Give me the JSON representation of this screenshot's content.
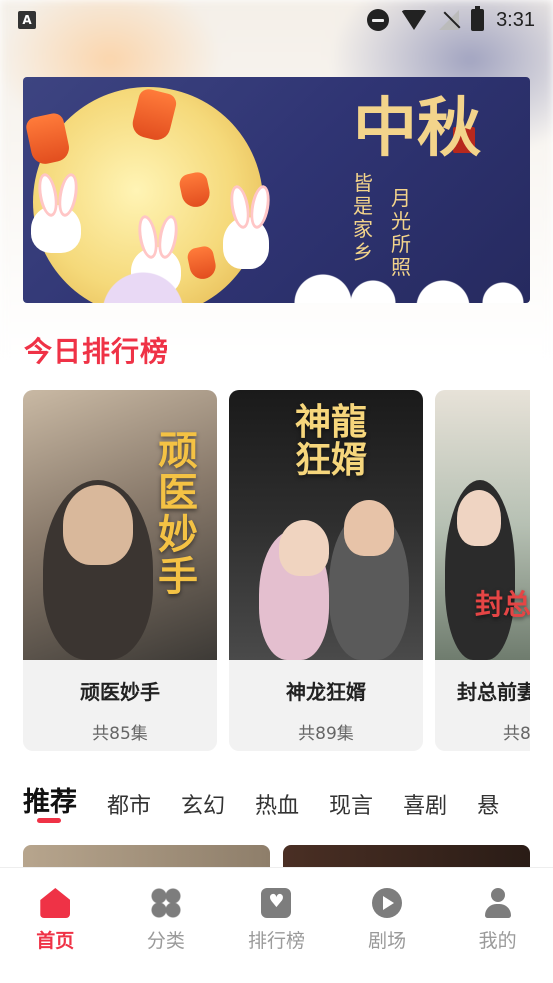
{
  "status_bar": {
    "app_icon_letter": "A",
    "time": "3:31"
  },
  "banner": {
    "title": "中秋",
    "subtitle_left": "皆是家乡",
    "subtitle_right": "月光所照"
  },
  "ranking": {
    "title": "今日排行榜",
    "cards": [
      {
        "title": "顽医妙手",
        "count": "共85集",
        "poster_text": "顽医妙手"
      },
      {
        "title": "神龙狂婿",
        "count": "共89集",
        "poster_text": "神龍狂婿"
      },
      {
        "title": "封总前妻",
        "count": "共8",
        "poster_text": "封总前"
      }
    ]
  },
  "categories": {
    "tabs": [
      "推荐",
      "都市",
      "玄幻",
      "热血",
      "现言",
      "喜剧",
      "悬"
    ],
    "active": "推荐"
  },
  "bottom_nav": {
    "items": [
      {
        "label": "首页",
        "icon": "home-icon",
        "active": true
      },
      {
        "label": "分类",
        "icon": "category-icon",
        "active": false
      },
      {
        "label": "排行榜",
        "icon": "rank-icon",
        "active": false
      },
      {
        "label": "剧场",
        "icon": "theater-icon",
        "active": false
      },
      {
        "label": "我的",
        "icon": "profile-icon",
        "active": false
      }
    ]
  },
  "colors": {
    "accent": "#ef3246",
    "nav_inactive": "#9a9a9a"
  }
}
